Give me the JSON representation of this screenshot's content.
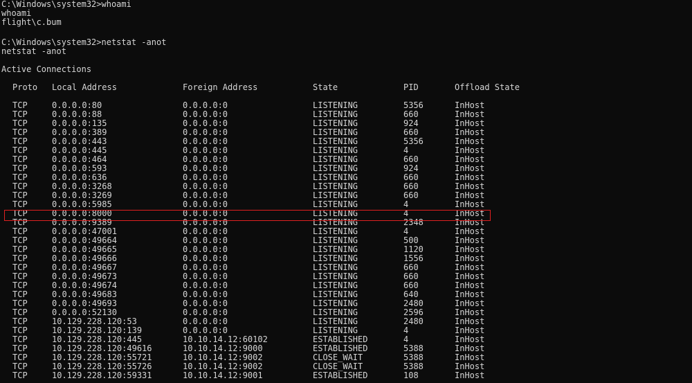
{
  "terminal": {
    "lines": [
      "C:\\Windows\\system32>whoami",
      "whoami",
      "flight\\c.bum",
      "",
      "C:\\Windows\\system32>netstat -anot",
      "netstat -anot",
      "",
      "Active Connections"
    ],
    "headers": {
      "proto": "Proto",
      "local": "Local Address",
      "foreign": "Foreign Address",
      "state": "State",
      "pid": "PID",
      "offload": "Offload State"
    },
    "rows": [
      {
        "proto": "TCP",
        "local": "0.0.0.0:80",
        "foreign": "0.0.0.0:0",
        "state": "LISTENING",
        "pid": "5356",
        "offload": "InHost"
      },
      {
        "proto": "TCP",
        "local": "0.0.0.0:88",
        "foreign": "0.0.0.0:0",
        "state": "LISTENING",
        "pid": "660",
        "offload": "InHost"
      },
      {
        "proto": "TCP",
        "local": "0.0.0.0:135",
        "foreign": "0.0.0.0:0",
        "state": "LISTENING",
        "pid": "924",
        "offload": "InHost"
      },
      {
        "proto": "TCP",
        "local": "0.0.0.0:389",
        "foreign": "0.0.0.0:0",
        "state": "LISTENING",
        "pid": "660",
        "offload": "InHost"
      },
      {
        "proto": "TCP",
        "local": "0.0.0.0:443",
        "foreign": "0.0.0.0:0",
        "state": "LISTENING",
        "pid": "5356",
        "offload": "InHost"
      },
      {
        "proto": "TCP",
        "local": "0.0.0.0:445",
        "foreign": "0.0.0.0:0",
        "state": "LISTENING",
        "pid": "4",
        "offload": "InHost"
      },
      {
        "proto": "TCP",
        "local": "0.0.0.0:464",
        "foreign": "0.0.0.0:0",
        "state": "LISTENING",
        "pid": "660",
        "offload": "InHost"
      },
      {
        "proto": "TCP",
        "local": "0.0.0.0:593",
        "foreign": "0.0.0.0:0",
        "state": "LISTENING",
        "pid": "924",
        "offload": "InHost"
      },
      {
        "proto": "TCP",
        "local": "0.0.0.0:636",
        "foreign": "0.0.0.0:0",
        "state": "LISTENING",
        "pid": "660",
        "offload": "InHost"
      },
      {
        "proto": "TCP",
        "local": "0.0.0.0:3268",
        "foreign": "0.0.0.0:0",
        "state": "LISTENING",
        "pid": "660",
        "offload": "InHost"
      },
      {
        "proto": "TCP",
        "local": "0.0.0.0:3269",
        "foreign": "0.0.0.0:0",
        "state": "LISTENING",
        "pid": "660",
        "offload": "InHost"
      },
      {
        "proto": "TCP",
        "local": "0.0.0.0:5985",
        "foreign": "0.0.0.0:0",
        "state": "LISTENING",
        "pid": "4",
        "offload": "InHost"
      },
      {
        "proto": "TCP",
        "local": "0.0.0.0:8000",
        "foreign": "0.0.0.0:0",
        "state": "LISTENING",
        "pid": "4",
        "offload": "InHost"
      },
      {
        "proto": "TCP",
        "local": "0.0.0.0:9389",
        "foreign": "0.0.0.0:0",
        "state": "LISTENING",
        "pid": "2348",
        "offload": "InHost"
      },
      {
        "proto": "TCP",
        "local": "0.0.0.0:47001",
        "foreign": "0.0.0.0:0",
        "state": "LISTENING",
        "pid": "4",
        "offload": "InHost"
      },
      {
        "proto": "TCP",
        "local": "0.0.0.0:49664",
        "foreign": "0.0.0.0:0",
        "state": "LISTENING",
        "pid": "500",
        "offload": "InHost"
      },
      {
        "proto": "TCP",
        "local": "0.0.0.0:49665",
        "foreign": "0.0.0.0:0",
        "state": "LISTENING",
        "pid": "1120",
        "offload": "InHost"
      },
      {
        "proto": "TCP",
        "local": "0.0.0.0:49666",
        "foreign": "0.0.0.0:0",
        "state": "LISTENING",
        "pid": "1556",
        "offload": "InHost"
      },
      {
        "proto": "TCP",
        "local": "0.0.0.0:49667",
        "foreign": "0.0.0.0:0",
        "state": "LISTENING",
        "pid": "660",
        "offload": "InHost"
      },
      {
        "proto": "TCP",
        "local": "0.0.0.0:49673",
        "foreign": "0.0.0.0:0",
        "state": "LISTENING",
        "pid": "660",
        "offload": "InHost"
      },
      {
        "proto": "TCP",
        "local": "0.0.0.0:49674",
        "foreign": "0.0.0.0:0",
        "state": "LISTENING",
        "pid": "660",
        "offload": "InHost"
      },
      {
        "proto": "TCP",
        "local": "0.0.0.0:49683",
        "foreign": "0.0.0.0:0",
        "state": "LISTENING",
        "pid": "640",
        "offload": "InHost"
      },
      {
        "proto": "TCP",
        "local": "0.0.0.0:49693",
        "foreign": "0.0.0.0:0",
        "state": "LISTENING",
        "pid": "2480",
        "offload": "InHost"
      },
      {
        "proto": "TCP",
        "local": "0.0.0.0:52130",
        "foreign": "0.0.0.0:0",
        "state": "LISTENING",
        "pid": "2596",
        "offload": "InHost"
      },
      {
        "proto": "TCP",
        "local": "10.129.228.120:53",
        "foreign": "0.0.0.0:0",
        "state": "LISTENING",
        "pid": "2480",
        "offload": "InHost"
      },
      {
        "proto": "TCP",
        "local": "10.129.228.120:139",
        "foreign": "0.0.0.0:0",
        "state": "LISTENING",
        "pid": "4",
        "offload": "InHost"
      },
      {
        "proto": "TCP",
        "local": "10.129.228.120:445",
        "foreign": "10.10.14.12:60102",
        "state": "ESTABLISHED",
        "pid": "4",
        "offload": "InHost"
      },
      {
        "proto": "TCP",
        "local": "10.129.228.120:49616",
        "foreign": "10.10.14.12:9000",
        "state": "ESTABLISHED",
        "pid": "5388",
        "offload": "InHost"
      },
      {
        "proto": "TCP",
        "local": "10.129.228.120:55721",
        "foreign": "10.10.14.12:9002",
        "state": "CLOSE_WAIT",
        "pid": "5388",
        "offload": "InHost"
      },
      {
        "proto": "TCP",
        "local": "10.129.228.120:55726",
        "foreign": "10.10.14.12:9002",
        "state": "CLOSE_WAIT",
        "pid": "5388",
        "offload": "InHost"
      },
      {
        "proto": "TCP",
        "local": "10.129.228.120:59331",
        "foreign": "10.10.14.12:9001",
        "state": "ESTABLISHED",
        "pid": "108",
        "offload": "InHost"
      }
    ],
    "highlighted_row": 12,
    "colors": {
      "background": "#0c0c0c",
      "text": "#d6d6d6",
      "highlight_border": "#e02020"
    }
  }
}
